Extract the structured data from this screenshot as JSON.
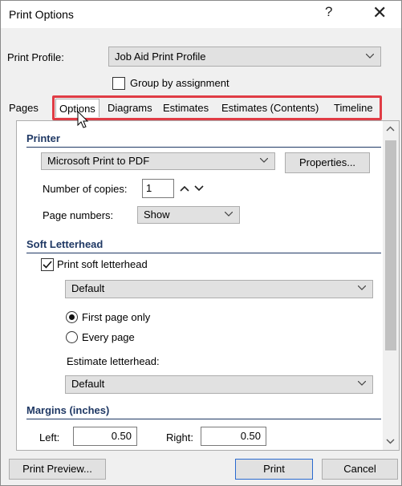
{
  "window": {
    "title": "Print Options",
    "help_glyph": "?",
    "close_glyph": "✕"
  },
  "profile": {
    "label": "Print Profile:",
    "value": "Job Aid Print Profile",
    "group_label": "Group by assignment"
  },
  "tabs": [
    "Pages",
    "Options",
    "Diagrams",
    "Estimates",
    "Estimates (Contents)",
    "Timeline"
  ],
  "printer": {
    "heading": "Printer",
    "device": "Microsoft Print to PDF",
    "properties_label": "Properties...",
    "copies_label": "Number of copies:",
    "copies_value": "1",
    "page_numbers_label": "Page numbers:",
    "page_numbers_value": "Show"
  },
  "letterhead": {
    "heading": "Soft Letterhead",
    "print_label": "Print soft letterhead",
    "style_value": "Default",
    "first_page_label": "First page only",
    "every_page_label": "Every page",
    "estimate_label": "Estimate letterhead:",
    "estimate_value": "Default"
  },
  "margins": {
    "heading": "Margins (inches)",
    "left_label": "Left:",
    "left_value": "0.50",
    "right_label": "Right:",
    "right_value": "0.50"
  },
  "footer": {
    "preview_label": "Print Preview...",
    "print_label": "Print",
    "cancel_label": "Cancel"
  }
}
